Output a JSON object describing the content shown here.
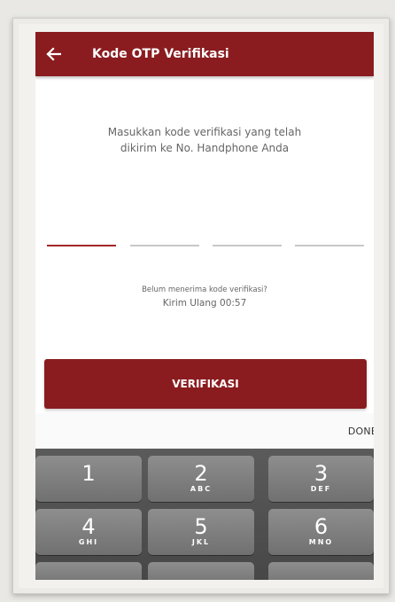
{
  "appbar": {
    "title": "Kode OTP Verifikasi"
  },
  "instruction": {
    "line1": "Masukkan kode verifikasi yang telah",
    "line2": "dikirim ke No. Handphone Anda"
  },
  "otp_fields": [
    {
      "value": "",
      "active": true
    },
    {
      "value": "",
      "active": false
    },
    {
      "value": "",
      "active": false
    },
    {
      "value": "",
      "active": false
    }
  ],
  "resend": {
    "question": "Belum menerima kode verifikasi?",
    "label": "Kirim Ulang",
    "timer": "00:57"
  },
  "verify_button": {
    "label": "VERIFIKASI"
  },
  "keyboard": {
    "done_label": "DONE",
    "keys": [
      {
        "num": "1",
        "letters": ""
      },
      {
        "num": "2",
        "letters": "ABC"
      },
      {
        "num": "3",
        "letters": "DEF"
      },
      {
        "num": "4",
        "letters": "GHI"
      },
      {
        "num": "5",
        "letters": "JKL"
      },
      {
        "num": "6",
        "letters": "MNO"
      }
    ]
  },
  "colors": {
    "brand": "#8a1c1f",
    "otp_active": "#a3272b",
    "otp_inactive": "#c8c8c8"
  },
  "icons": {
    "back": "arrow-left-icon"
  }
}
